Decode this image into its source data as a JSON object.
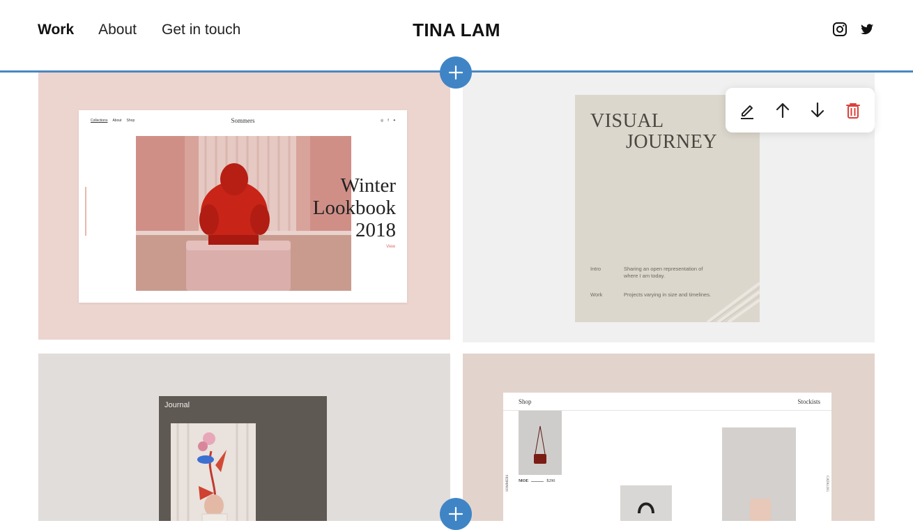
{
  "header": {
    "nav": [
      {
        "label": "Work",
        "active": true
      },
      {
        "label": "About"
      },
      {
        "label": "Get in touch"
      }
    ],
    "brand": "TINA LAM",
    "social_icons": [
      "instagram-icon",
      "twitter-icon"
    ],
    "divider_color": "#4a87c2"
  },
  "add_section_icon": "plus-icon",
  "toolbar": {
    "icons": [
      "edit-icon",
      "move-up-icon",
      "move-down-icon",
      "delete-icon"
    ],
    "delete_color": "#d9423a"
  },
  "tiles": {
    "winter_lookbook": {
      "background": "#ecd4cf",
      "mock_nav": [
        "Collections",
        "About",
        "Shop"
      ],
      "mock_brand": "Sommers",
      "caption_line1": "Winter",
      "caption_line2": "Lookbook",
      "caption_line3": "2018",
      "view_label": "View"
    },
    "visual_journey": {
      "background": "#f0f0f1",
      "title_line1": "VISUAL",
      "title_line2": "JOURNEY",
      "rows": [
        {
          "key": "Intro",
          "value": "Sharing an open representation of where I am today."
        },
        {
          "key": "Work",
          "value": "Projects varying in size and timelines."
        }
      ]
    },
    "journal": {
      "background": "#e0dddb",
      "title": "Journal"
    },
    "shop": {
      "background": "#e2d4cc",
      "left_label": "Shop",
      "right_label": "Stockists",
      "product_name": "MOE",
      "product_price": "$290",
      "side_left": "SOMMERS",
      "side_right": "CATALOG"
    }
  }
}
